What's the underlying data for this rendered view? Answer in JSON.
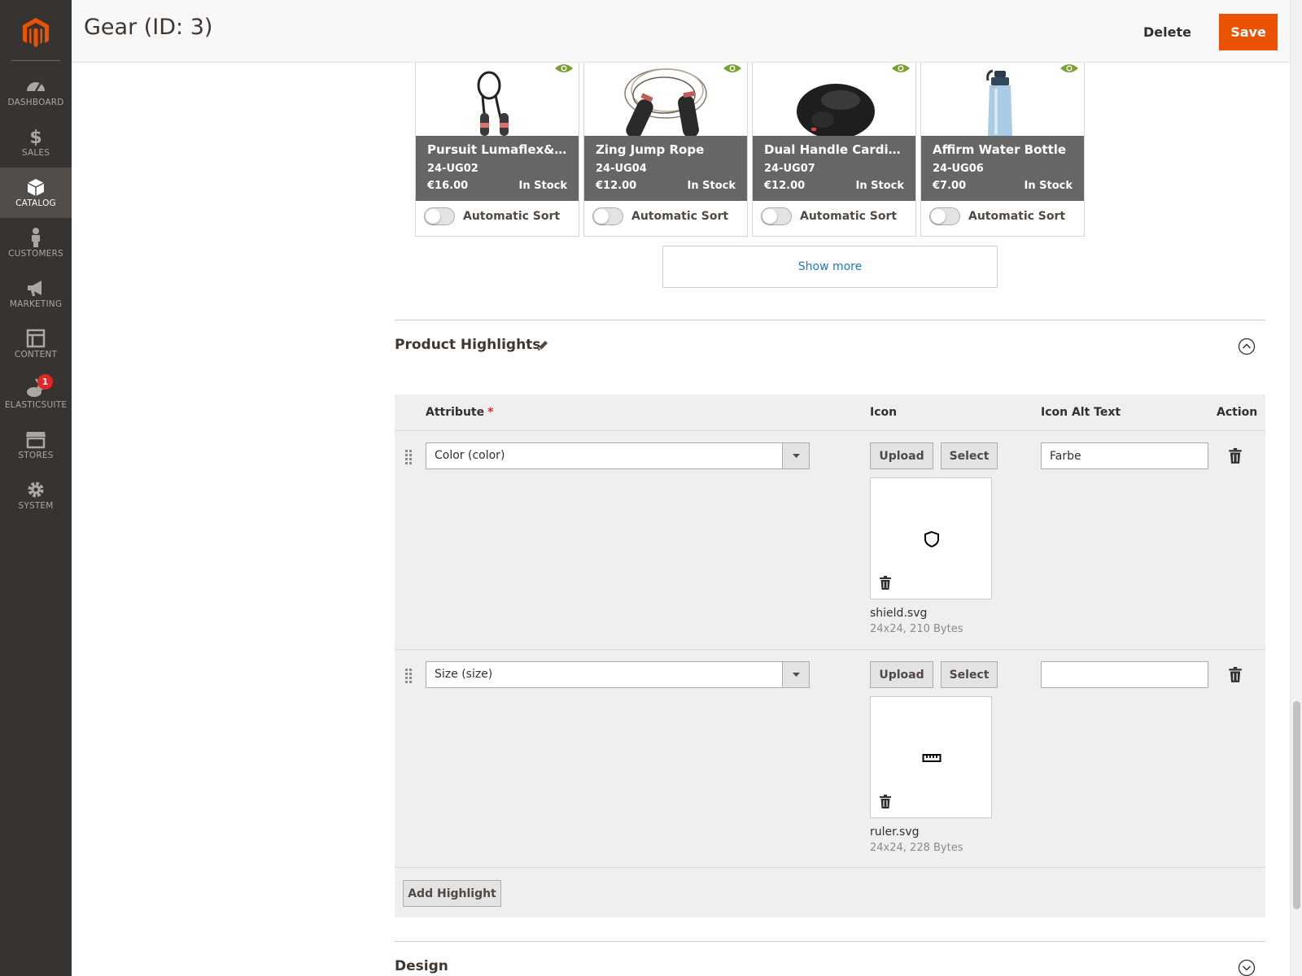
{
  "sidebar": {
    "logo": "magento-logo",
    "items": [
      {
        "label": "DASHBOARD",
        "icon": "dashboard-icon"
      },
      {
        "label": "SALES",
        "icon": "dollar-icon"
      },
      {
        "label": "CATALOG",
        "icon": "cube-icon",
        "active": true
      },
      {
        "label": "CUSTOMERS",
        "icon": "person-icon"
      },
      {
        "label": "MARKETING",
        "icon": "megaphone-icon"
      },
      {
        "label": "CONTENT",
        "icon": "layout-icon"
      },
      {
        "label": "ELASTICSUITE",
        "icon": "rabbit-icon",
        "badge": "1"
      },
      {
        "label": "STORES",
        "icon": "store-icon"
      },
      {
        "label": "SYSTEM",
        "icon": "gear-icon"
      }
    ]
  },
  "header": {
    "title": "Gear (ID: 3)",
    "delete_label": "Delete",
    "save_label": "Save"
  },
  "products": [
    {
      "name": "Pursuit Lumaflex&t...",
      "sku": "24-UG02",
      "price": "€16.00",
      "stock": "In Stock",
      "sort_label": "Automatic Sort",
      "image": "jump-rope-red-icon"
    },
    {
      "name": "Zing Jump Rope",
      "sku": "24-UG04",
      "price": "€12.00",
      "stock": "In Stock",
      "sort_label": "Automatic Sort",
      "image": "jump-rope-black-icon"
    },
    {
      "name": "Dual Handle Cardio...",
      "sku": "24-UG07",
      "price": "€12.00",
      "stock": "In Stock",
      "sort_label": "Automatic Sort",
      "image": "kettlebell-icon"
    },
    {
      "name": "Affirm Water Bottle",
      "sku": "24-UG06",
      "price": "€7.00",
      "stock": "In Stock",
      "sort_label": "Automatic Sort",
      "image": "water-bottle-icon"
    }
  ],
  "show_more_label": "Show more",
  "highlights": {
    "title": "Product Highlights",
    "columns": {
      "attribute": "Attribute",
      "required_mark": "*",
      "icon": "Icon",
      "alt_text": "Icon Alt Text",
      "action": "Action"
    },
    "rows": [
      {
        "attribute": "Color (color)",
        "upload_label": "Upload",
        "select_label": "Select",
        "icon": "shield-icon",
        "file_name": "shield.svg",
        "file_meta": "24x24, 210 Bytes",
        "alt_text": "Farbe"
      },
      {
        "attribute": "Size (size)",
        "upload_label": "Upload",
        "select_label": "Select",
        "icon": "ruler-icon",
        "file_name": "ruler.svg",
        "file_meta": "24x24, 228 Bytes",
        "alt_text": ""
      }
    ],
    "add_label": "Add Highlight"
  },
  "design": {
    "title": "Design"
  },
  "colors": {
    "accent": "#eb5202",
    "link": "#1979c3",
    "sidebar": "#373330",
    "eye": "#79a22e"
  }
}
